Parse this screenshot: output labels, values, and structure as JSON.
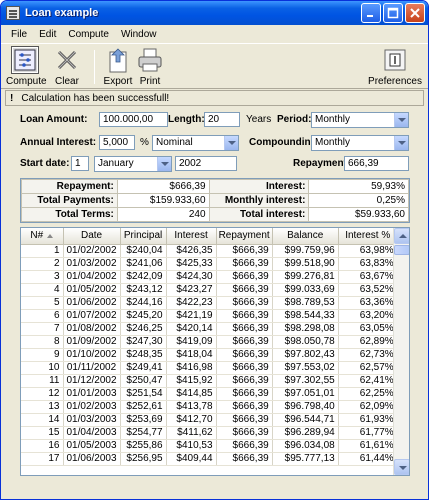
{
  "window": {
    "title": "Loan example"
  },
  "menu": [
    "File",
    "Edit",
    "Compute",
    "Window"
  ],
  "toolbar": {
    "compute": "Compute",
    "clear": "Clear",
    "export": "Export",
    "print": "Print",
    "preferences": "Preferences"
  },
  "status": {
    "icon": "!",
    "text": "Calculation has been successfull!"
  },
  "form": {
    "loan_amount_label": "Loan Amount:",
    "loan_amount": "100.000,00",
    "length_label": "Length:",
    "length": "20",
    "length_unit": "Years",
    "period_label": "Period:",
    "period": "Monthly",
    "interest_label": "Annual Interest:",
    "interest": "5,000",
    "interest_unit": "%",
    "interest_type": "Nominal",
    "compounding_label": "Compounding:",
    "compounding": "Monthly",
    "start_label": "Start date:",
    "start_day": "1",
    "start_month": "January",
    "start_year": "2002",
    "repayment_label": "Repayment:",
    "repayment": "666,39"
  },
  "summary": {
    "rows": [
      {
        "k1": "Repayment:",
        "v1": "$666,39",
        "k2": "Interest:",
        "v2": "59,93%"
      },
      {
        "k1": "Total Payments:",
        "v1": "$159.933,60",
        "k2": "Monthly interest:",
        "v2": "0,25%"
      },
      {
        "k1": "Total Terms:",
        "v1": "240",
        "k2": "Total interest:",
        "v2": "$59.933,60"
      }
    ]
  },
  "grid": {
    "headers": [
      "N#",
      "Date",
      "Principal",
      "Interest",
      "Repayment",
      "Balance",
      "Interest %"
    ],
    "rows": [
      [
        "1",
        "01/02/2002",
        "$240,04",
        "$426,35",
        "$666,39",
        "$99.759,96",
        "63,98%"
      ],
      [
        "2",
        "01/03/2002",
        "$241,06",
        "$425,33",
        "$666,39",
        "$99.518,90",
        "63,83%"
      ],
      [
        "3",
        "01/04/2002",
        "$242,09",
        "$424,30",
        "$666,39",
        "$99.276,81",
        "63,67%"
      ],
      [
        "4",
        "01/05/2002",
        "$243,12",
        "$423,27",
        "$666,39",
        "$99.033,69",
        "63,52%"
      ],
      [
        "5",
        "01/06/2002",
        "$244,16",
        "$422,23",
        "$666,39",
        "$98.789,53",
        "63,36%"
      ],
      [
        "6",
        "01/07/2002",
        "$245,20",
        "$421,19",
        "$666,39",
        "$98.544,33",
        "63,20%"
      ],
      [
        "7",
        "01/08/2002",
        "$246,25",
        "$420,14",
        "$666,39",
        "$98.298,08",
        "63,05%"
      ],
      [
        "8",
        "01/09/2002",
        "$247,30",
        "$419,09",
        "$666,39",
        "$98.050,78",
        "62,89%"
      ],
      [
        "9",
        "01/10/2002",
        "$248,35",
        "$418,04",
        "$666,39",
        "$97.802,43",
        "62,73%"
      ],
      [
        "10",
        "01/11/2002",
        "$249,41",
        "$416,98",
        "$666,39",
        "$97.553,02",
        "62,57%"
      ],
      [
        "11",
        "01/12/2002",
        "$250,47",
        "$415,92",
        "$666,39",
        "$97.302,55",
        "62,41%"
      ],
      [
        "12",
        "01/01/2003",
        "$251,54",
        "$414,85",
        "$666,39",
        "$97.051,01",
        "62,25%"
      ],
      [
        "13",
        "01/02/2003",
        "$252,61",
        "$413,78",
        "$666,39",
        "$96.798,40",
        "62,09%"
      ],
      [
        "14",
        "01/03/2003",
        "$253,69",
        "$412,70",
        "$666,39",
        "$96.544,71",
        "61,93%"
      ],
      [
        "15",
        "01/04/2003",
        "$254,77",
        "$411,62",
        "$666,39",
        "$96.289,94",
        "61,77%"
      ],
      [
        "16",
        "01/05/2003",
        "$255,86",
        "$410,53",
        "$666,39",
        "$96.034,08",
        "61,61%"
      ],
      [
        "17",
        "01/06/2003",
        "$256,95",
        "$409,44",
        "$666,39",
        "$95.777,13",
        "61,44%"
      ]
    ]
  }
}
